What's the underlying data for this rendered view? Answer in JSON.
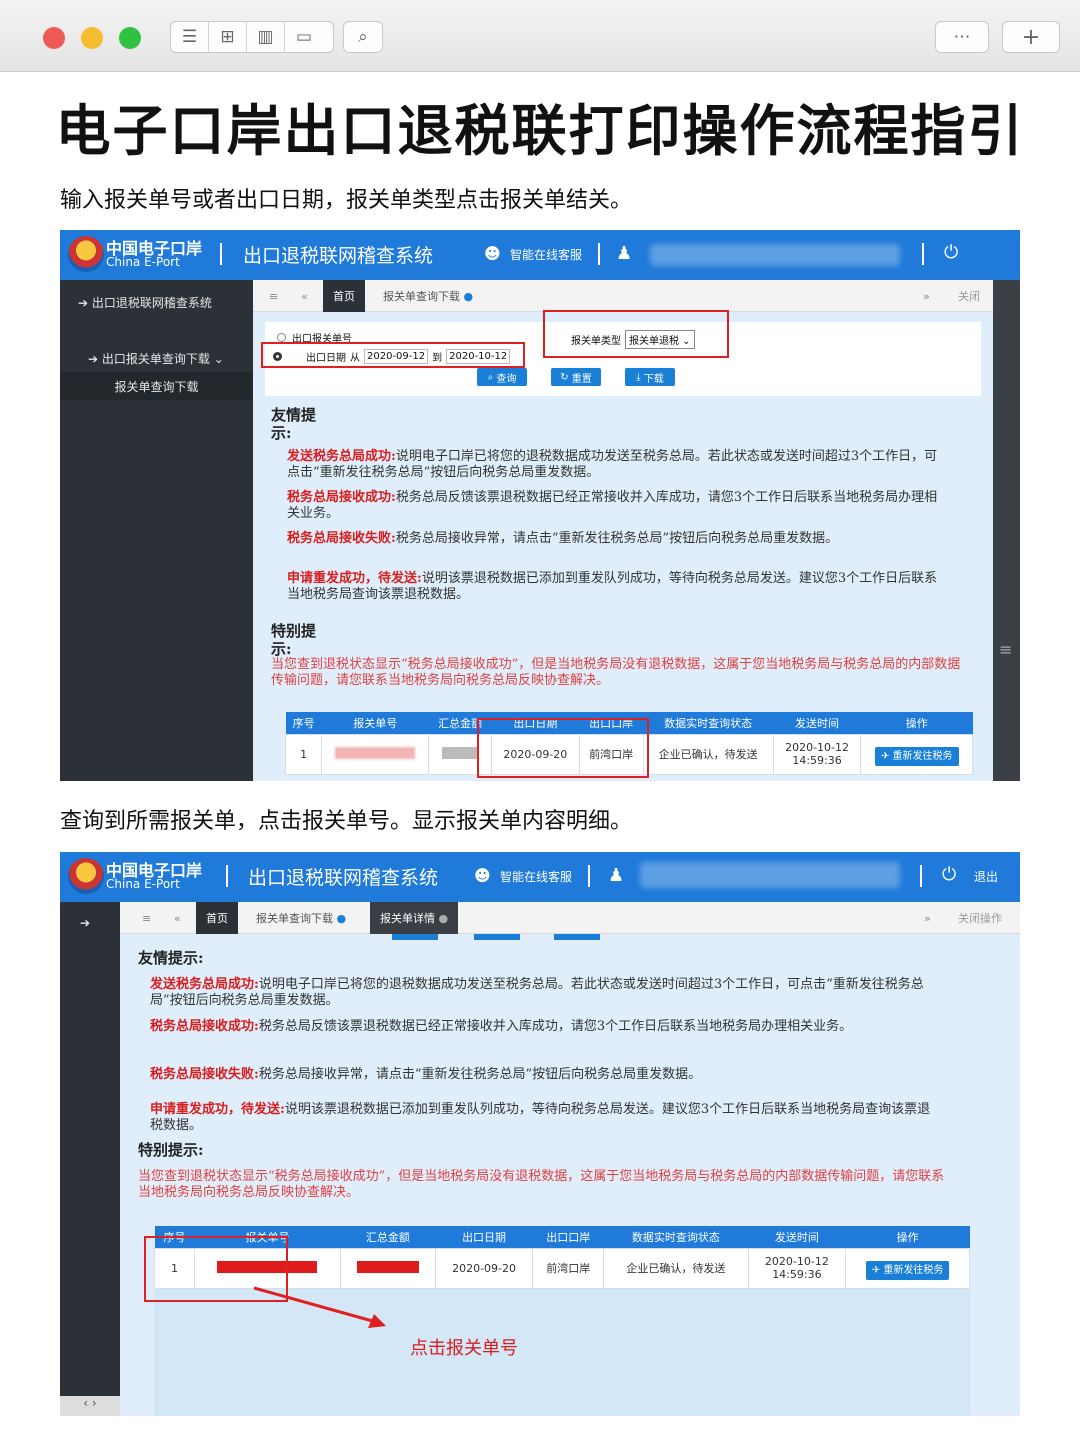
{
  "window": {
    "toolbar_icons": [
      "list-icon",
      "grid-icon",
      "map-icon",
      "sidebar-icon",
      "search-icon"
    ],
    "right_icons": [
      "more-icon",
      "plus-icon"
    ]
  },
  "title": "电子口岸出口退税联打印操作流程指引",
  "step1": "输入报关单号或者出口日期，报关单类型点击报关单结关。",
  "step2": "查询到所需报关单，点击报关单号。显示报关单内容明细。",
  "app": {
    "logo_cn": "中国电子口岸",
    "logo_en": "China E-Port",
    "system_name": "出口退税联网稽查系统",
    "online_service": "智能在线客服",
    "logout": "退出",
    "close_ops": "关闭操作"
  },
  "shot1": {
    "sidebar": {
      "menu_root": "出口退税联网稽查系统",
      "menu_sub": "出口报关单查询下载",
      "menu_leaf": "报关单查询下载"
    },
    "tabs": [
      "首页",
      "报关单查询下载"
    ],
    "close_label": "关闭",
    "form": {
      "option1": "出口报关单号",
      "option2_label": "出口日期",
      "from_label": "从",
      "from_date": "2020-09-12",
      "to_label": "到",
      "to_date": "2020-10-12",
      "type_label": "报关单类型",
      "type_value": "报关单退税"
    },
    "buttons": [
      "查询",
      "重置",
      "下载"
    ]
  },
  "tips": {
    "heading": "友情提示:",
    "items": [
      {
        "label": "发送税务总局成功:",
        "text": "说明电子口岸已将您的退税数据成功发送至税务总局。若此状态或发送时间超过3个工作日，可点击“重新发往税务总局”按钮后向税务总局重发数据。"
      },
      {
        "label": "税务总局接收成功:",
        "text": "税务总局反馈该票退税数据已经正常接收并入库成功，请您3个工作日后联系当地税务局办理相关业务。"
      },
      {
        "label": "税务总局接收失败:",
        "text": "税务总局接收异常，请点击“重新发往税务总局”按钮后向税务总局重发数据。"
      },
      {
        "label": "申请重发成功，待发送:",
        "text": "说明该票退税数据已添加到重发队列成功，等待向税务总局发送。建议您3个工作日后联系当地税务局查询该票退税数据。"
      }
    ],
    "special_heading": "特别提示:",
    "special_text": "当您查到退税状态显示“税务总局接收成功”，但是当地税务局没有退税数据，这属于您当地税务局与税务总局的内部数据传输问题，请您联系当地税务局向税务总局反映协查解决。"
  },
  "table": {
    "headers": [
      "序号",
      "报关单号",
      "汇总金额",
      "出口日期",
      "出口口岸",
      "数据实时查询状态",
      "发送时间",
      "操作"
    ],
    "row": {
      "index": "1",
      "export_date": "2020-09-20",
      "port": "前湾口岸",
      "status": "企业已确认，待发送",
      "send_date": "2020-10-12",
      "send_time": "14:59:36",
      "action": "重新发往税务"
    }
  },
  "shot2": {
    "tabs": [
      "首页",
      "报关单查询下载",
      "报关单详情"
    ],
    "annotation": "点击报关单号"
  }
}
